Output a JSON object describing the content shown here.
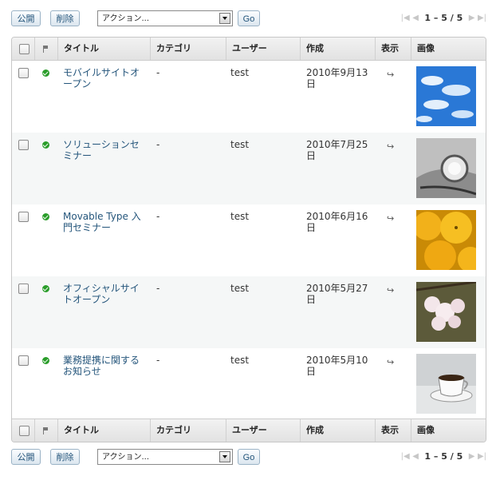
{
  "toolbar": {
    "publish_label": "公開",
    "delete_label": "削除",
    "action_select": "アクション...",
    "go_label": "Go",
    "pager_text": "1 – 5 / 5"
  },
  "columns": {
    "title": "タイトル",
    "category": "カテゴリ",
    "user": "ユーザー",
    "created": "作成",
    "view": "表示",
    "image": "画像"
  },
  "rows": [
    {
      "title": "モバイルサイトオープン",
      "category": "-",
      "user": "test",
      "date": "2010年9月13日",
      "image": "blue-sky-clouds"
    },
    {
      "title": "ソリューションセミナー",
      "category": "-",
      "user": "test",
      "date": "2010年7月25日",
      "image": "car-headlight"
    },
    {
      "title": "Movable Type 入門セミナー",
      "category": "-",
      "user": "test",
      "date": "2010年6月16日",
      "image": "oranges"
    },
    {
      "title": "オフィシャルサイトオープン",
      "category": "-",
      "user": "test",
      "date": "2010年5月27日",
      "image": "cherry-blossoms"
    },
    {
      "title": "業務提携に関するお知らせ",
      "category": "-",
      "user": "test",
      "date": "2010年5月10日",
      "image": "coffee-cup"
    }
  ],
  "icons": {
    "view": "arrow-right-icon",
    "status": "published-check-icon",
    "flag": "flag-icon"
  },
  "colors": {
    "link": "#24557b",
    "status": "#2a9d2a"
  }
}
